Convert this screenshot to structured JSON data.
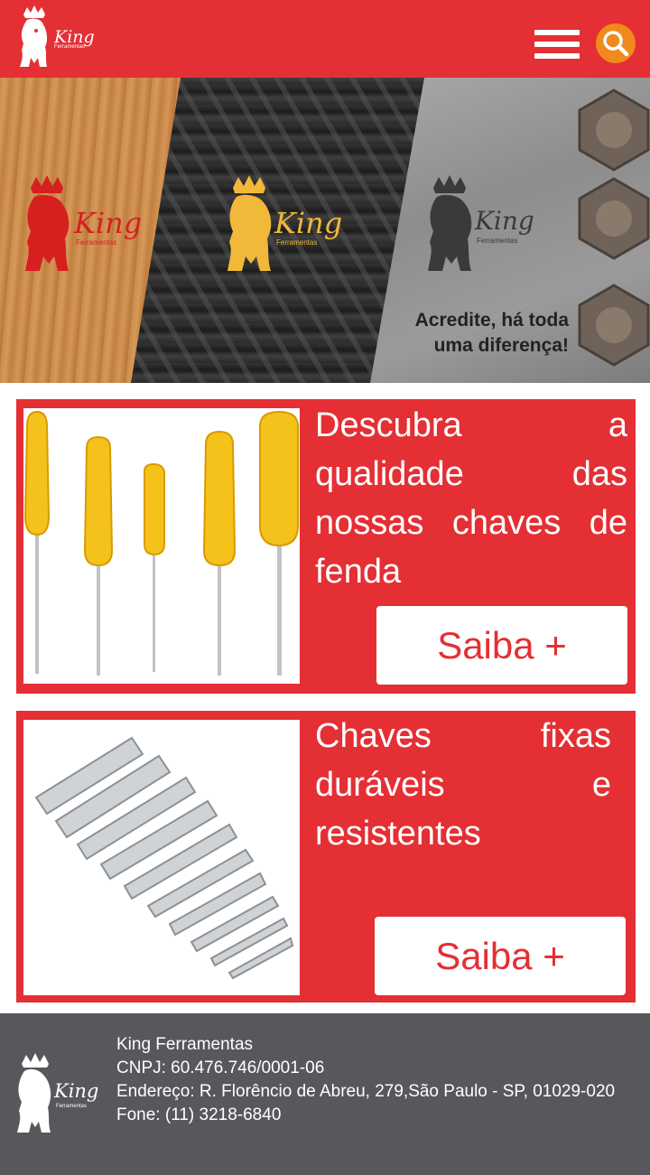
{
  "header": {
    "brand": "King",
    "brand_sub": "Ferramentas",
    "menu_icon": "hamburger-icon",
    "search_icon": "search-icon",
    "colors": {
      "primary": "#e42f34",
      "search": "#f08a1c"
    }
  },
  "banner": {
    "logos": [
      {
        "brand": "King",
        "sub": "Ferramentas",
        "color": "#d6201f"
      },
      {
        "brand": "King",
        "sub": "Ferramentas",
        "color": "#f2b83a"
      },
      {
        "brand": "King",
        "sub": "Ferramentas",
        "color": "#3a3a3a"
      }
    ],
    "tagline_line1": "Acredite, há toda",
    "tagline_line2": "uma diferença!"
  },
  "cards": [
    {
      "title": "Descubra a qualidade das nossas chaves de fenda",
      "button": "Saiba +"
    },
    {
      "title": "Chaves fixas duráveis e resistentes",
      "button": "Saiba +"
    }
  ],
  "footer": {
    "brand": "King",
    "brand_sub": "Ferramentas",
    "company": "King Ferramentas",
    "cnpj": "CNPJ: 60.476.746/0001-06",
    "address": "Endereço: R. Florêncio de Abreu, 279,São Paulo - SP, 01029-020",
    "phone": "Fone:  (11) 3218-6840"
  }
}
